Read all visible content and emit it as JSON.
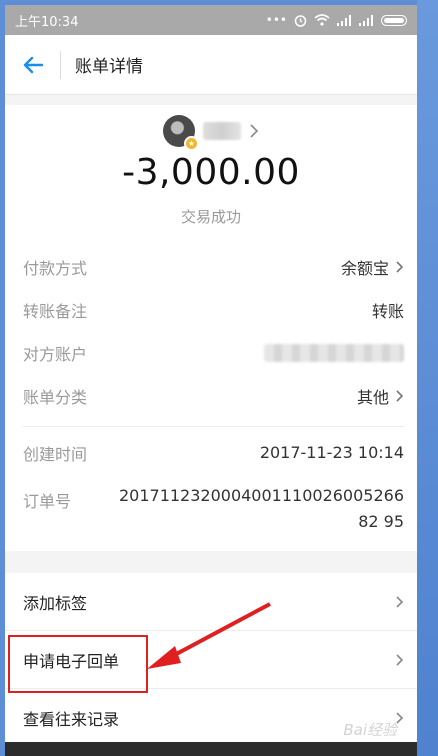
{
  "status_bar": {
    "time": "上午10:34",
    "icons": [
      "more-dots-icon",
      "alarm-icon",
      "wifi-icon",
      "signal-icon",
      "signal-icon",
      "battery-icon"
    ]
  },
  "header": {
    "title": "账单详情",
    "back_icon": "arrow-left-icon",
    "accent_color": "#1a8cf0"
  },
  "summary": {
    "amount": "-3,000.00",
    "status": "交易成功"
  },
  "details": [
    {
      "label": "付款方式",
      "value": "余额宝",
      "chevron": true
    },
    {
      "label": "转账备注",
      "value": "转账",
      "chevron": false
    },
    {
      "label": "对方账户",
      "value": "",
      "chevron": false
    },
    {
      "label": "账单分类",
      "value": "其他",
      "chevron": true
    }
  ],
  "meta": {
    "create_time_label": "创建时间",
    "create_time_value": "2017-11-23 10:14",
    "order_no_label": "订单号",
    "order_no_value": "201711232000400111002600526682 95"
  },
  "actions": [
    {
      "label": "添加标签"
    },
    {
      "label": "申请电子回单"
    },
    {
      "label": "查看往来记录"
    }
  ],
  "annotation": {
    "highlight_color": "#e02020"
  },
  "watermark": "Bai经验"
}
